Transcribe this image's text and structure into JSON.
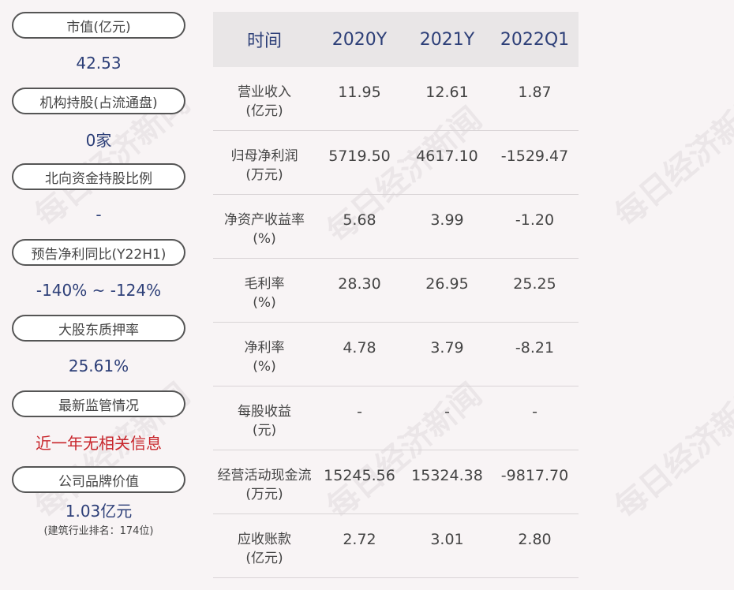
{
  "left_items": [
    {
      "label": "市值(亿元)",
      "value": "42.53"
    },
    {
      "label": "机构持股(占流通盘)",
      "value": "0家"
    },
    {
      "label": "北向资金持股比例",
      "value": "-"
    },
    {
      "label": "预告净利同比(Y22H1)",
      "value": "-140% ~ -124%"
    },
    {
      "label": "大股东质押率",
      "value": "25.61%"
    },
    {
      "label": "最新监管情况",
      "value": "近一年无相关信息"
    },
    {
      "label": "公司品牌价值",
      "value": "1.03亿元",
      "sub": "(建筑行业排名：174位)"
    }
  ],
  "table": {
    "headers": [
      "时间",
      "2020Y",
      "2021Y",
      "2022Q1"
    ],
    "rows": [
      {
        "name": "营业收入",
        "unit": "(亿元)",
        "values": [
          "11.95",
          "12.61",
          "1.87"
        ]
      },
      {
        "name": "归母净利润",
        "unit": "(万元)",
        "values": [
          "5719.50",
          "4617.10",
          "-1529.47"
        ]
      },
      {
        "name": "净资产收益率",
        "unit": "(%)",
        "values": [
          "5.68",
          "3.99",
          "-1.20"
        ]
      },
      {
        "name": "毛利率",
        "unit": "(%)",
        "values": [
          "28.30",
          "26.95",
          "25.25"
        ]
      },
      {
        "name": "净利率",
        "unit": "(%)",
        "values": [
          "4.78",
          "3.79",
          "-8.21"
        ]
      },
      {
        "name": "每股收益",
        "unit": "(元)",
        "values": [
          "-",
          "-",
          "-"
        ]
      },
      {
        "name": "经营活动现金流",
        "unit": "(万元)",
        "values": [
          "15245.56",
          "15324.38",
          "-9817.70"
        ]
      },
      {
        "name": "应收账款",
        "unit": "(亿元)",
        "values": [
          "2.72",
          "3.01",
          "2.80"
        ]
      }
    ]
  },
  "watermark": "每日经济新闻",
  "colors": {
    "value_blue": "#2d3f78",
    "alert_red": "#c8262c",
    "background": "#f8f4f5"
  }
}
